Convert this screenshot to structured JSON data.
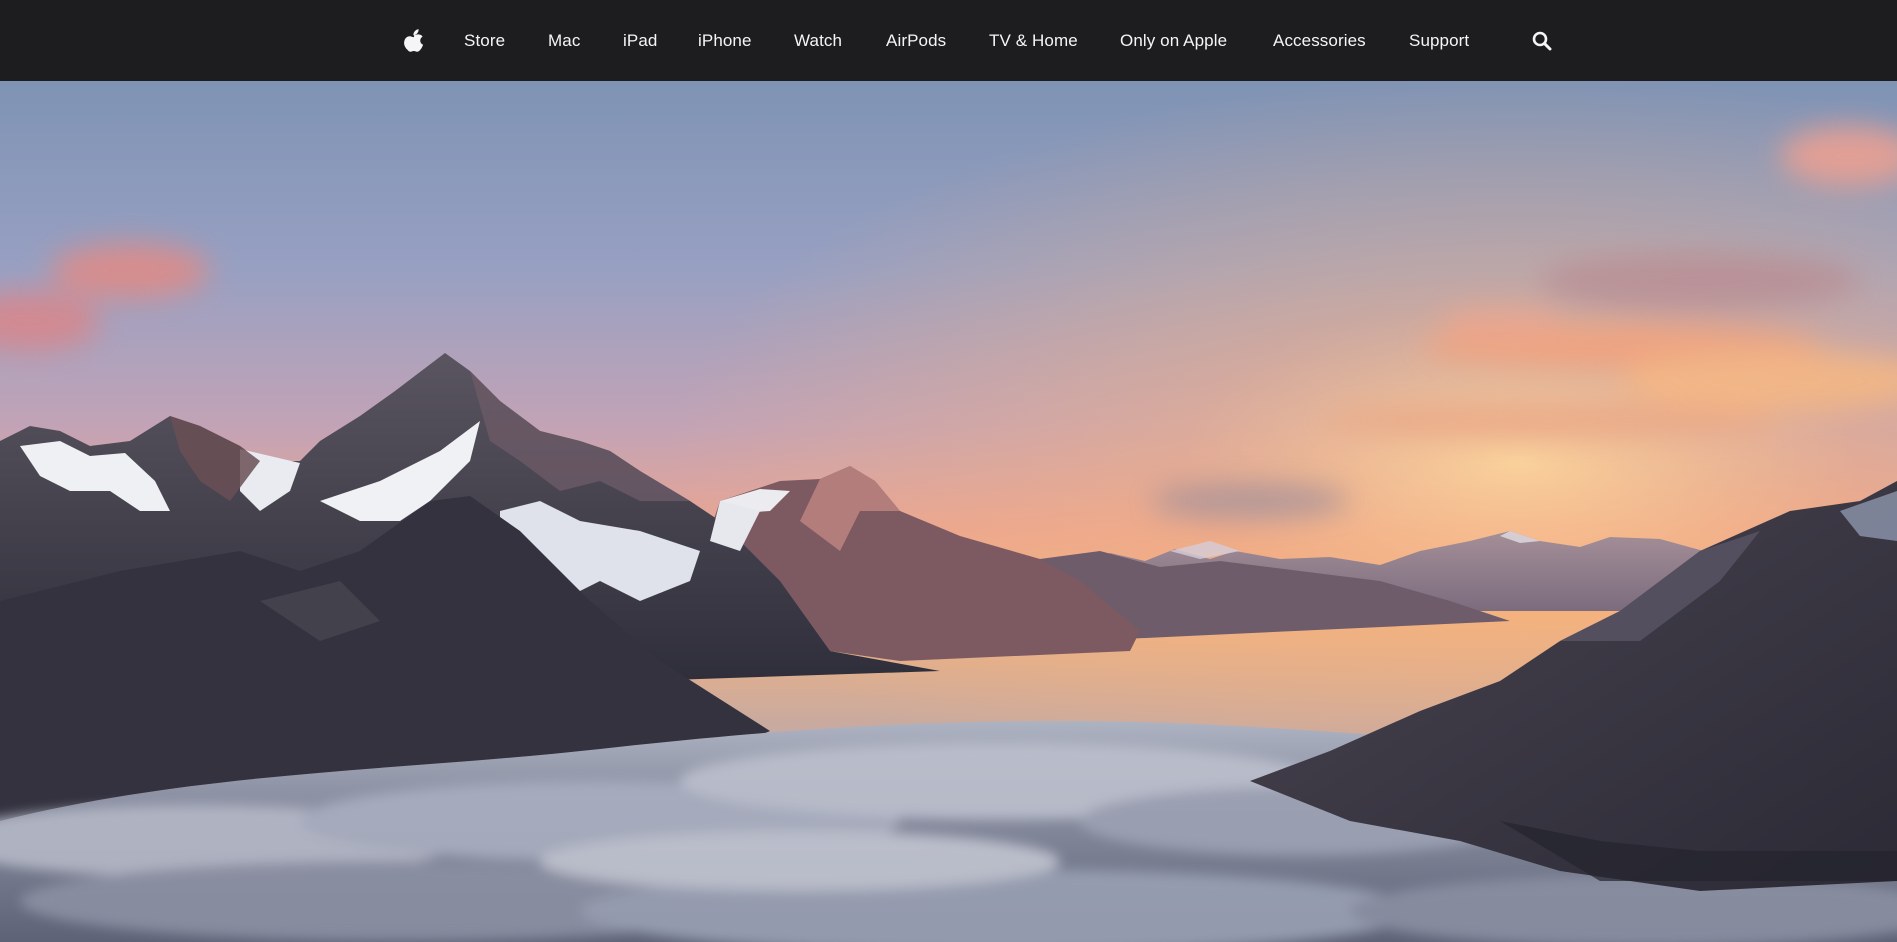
{
  "nav": {
    "items": [
      {
        "label": "Store"
      },
      {
        "label": "Mac"
      },
      {
        "label": "iPad"
      },
      {
        "label": "iPhone"
      },
      {
        "label": "Watch"
      },
      {
        "label": "AirPods"
      },
      {
        "label": "TV & Home"
      },
      {
        "label": "Only on Apple"
      },
      {
        "label": "Accessories"
      },
      {
        "label": "Support"
      }
    ],
    "apple_icon": "apple-logo-icon",
    "search_icon": "search-icon"
  },
  "hero": {
    "image": "mountain-sunrise-above-clouds"
  },
  "colors": {
    "nav_background": "#1d1d1f",
    "nav_text": "#f5f5f7"
  }
}
